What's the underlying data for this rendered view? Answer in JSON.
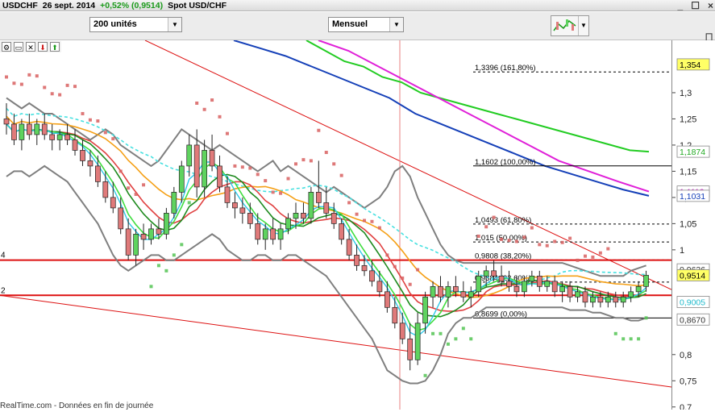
{
  "window": {
    "symbol": "USDCHF",
    "date": "26 sept. 2014",
    "change": "+0,52% (0,9514)",
    "name": "Spot USD/CHF",
    "controls": [
      "_",
      "☐",
      "×"
    ]
  },
  "toolbar": {
    "units_select": "200 unités",
    "period_select": "Mensuel"
  },
  "footer": {
    "text": "RealTime.com - Données en fin de journée"
  },
  "colors": {
    "up": "#5fd35f",
    "down": "#e07a7a",
    "bb": "#7f7f7f",
    "green200": "#22cc22",
    "magenta": "#e020d8",
    "blue": "#1540b8",
    "orange": "#f5a016",
    "cyan": "#45e0e0",
    "red_line": "#dd1111",
    "sar": "#53c453",
    "sar_down": "#d86060"
  },
  "chart_data": {
    "type": "candlestick",
    "instrument": "USDCHF",
    "period": "Mensuel",
    "y_axis": {
      "range": [
        0.7,
        1.4
      ],
      "ticks": [
        "1,3",
        "1,25",
        "1,2",
        "1,15",
        "1,1",
        "1,05",
        "1",
        "0,8",
        "0,75",
        "0,7"
      ],
      "tick_values": [
        1.3,
        1.25,
        1.2,
        1.15,
        1.1,
        1.05,
        1.0,
        0.8,
        0.75,
        0.7
      ]
    },
    "value_tags": [
      {
        "label": "1,354",
        "value": 1.354,
        "bg": "#ffff66"
      },
      {
        "label": "1,1874",
        "value": 1.1874,
        "bg": "#ffffff",
        "color": "#22aa22"
      },
      {
        "label": "1,1112",
        "value": 1.1112,
        "bg": "#ffffff",
        "color": "#d020d0"
      },
      {
        "label": "1,1031",
        "value": 1.1031,
        "bg": "#ffffff",
        "color": "#1540b8"
      },
      {
        "label": "0,9626",
        "value": 0.9626,
        "bg": "#ffffff",
        "color": "#333333"
      },
      {
        "label": "0,9514",
        "value": 0.9514,
        "bg": "#ffff66",
        "color": "#000000"
      },
      {
        "label": "0,9005",
        "value": 0.9005,
        "bg": "#ffffff",
        "color": "#22bbcc"
      },
      {
        "label": "0,8670",
        "value": 0.867,
        "bg": "#ffffff",
        "color": "#333333"
      }
    ],
    "fibonacci": [
      {
        "label": "1,3396 (161,80%)",
        "value": 1.3396
      },
      {
        "label": "1,1602 (100,00%)",
        "value": 1.1602
      },
      {
        "label": "1,0493 (61,80%)",
        "value": 1.0493
      },
      {
        "label": "1,015 (50,00%)",
        "value": 1.015
      },
      {
        "label": "0,9808 (38,20%)",
        "value": 0.9808
      },
      {
        "label": "0,9384 (23,60%)",
        "value": 0.9384
      },
      {
        "label": "0,8699 (0,00%)",
        "value": 0.8699
      }
    ],
    "horizontal_levels": [
      {
        "label": "4",
        "value": 0.9804
      },
      {
        "label": "2",
        "value": 0.9131
      }
    ],
    "candles": [
      [
        1.25,
        1.28,
        1.22,
        1.24
      ],
      [
        1.24,
        1.26,
        1.2,
        1.21
      ],
      [
        1.21,
        1.25,
        1.19,
        1.24
      ],
      [
        1.24,
        1.26,
        1.21,
        1.22
      ],
      [
        1.22,
        1.25,
        1.2,
        1.24
      ],
      [
        1.24,
        1.26,
        1.21,
        1.22
      ],
      [
        1.22,
        1.24,
        1.19,
        1.21
      ],
      [
        1.21,
        1.23,
        1.19,
        1.22
      ],
      [
        1.22,
        1.24,
        1.2,
        1.21
      ],
      [
        1.21,
        1.23,
        1.18,
        1.19
      ],
      [
        1.19,
        1.21,
        1.16,
        1.17
      ],
      [
        1.17,
        1.19,
        1.14,
        1.16
      ],
      [
        1.16,
        1.18,
        1.12,
        1.13
      ],
      [
        1.13,
        1.15,
        1.09,
        1.1
      ],
      [
        1.1,
        1.13,
        1.07,
        1.08
      ],
      [
        1.08,
        1.1,
        1.03,
        1.04
      ],
      [
        1.04,
        1.06,
        0.98,
        0.99
      ],
      [
        0.99,
        1.04,
        0.97,
        1.03
      ],
      [
        1.03,
        1.05,
        1.0,
        1.02
      ],
      [
        1.02,
        1.05,
        1.01,
        1.04
      ],
      [
        1.04,
        1.06,
        1.02,
        1.03
      ],
      [
        1.03,
        1.08,
        1.02,
        1.07
      ],
      [
        1.07,
        1.12,
        1.06,
        1.11
      ],
      [
        1.11,
        1.17,
        1.09,
        1.16
      ],
      [
        1.16,
        1.22,
        1.14,
        1.2
      ],
      [
        1.2,
        1.23,
        1.1,
        1.12
      ],
      [
        1.12,
        1.21,
        1.1,
        1.19
      ],
      [
        1.19,
        1.22,
        1.15,
        1.16
      ],
      [
        1.16,
        1.18,
        1.11,
        1.12
      ],
      [
        1.12,
        1.14,
        1.08,
        1.09
      ],
      [
        1.09,
        1.11,
        1.06,
        1.08
      ],
      [
        1.08,
        1.1,
        1.05,
        1.07
      ],
      [
        1.07,
        1.09,
        1.04,
        1.05
      ],
      [
        1.05,
        1.07,
        1.01,
        1.02
      ],
      [
        1.02,
        1.05,
        1.0,
        1.04
      ],
      [
        1.04,
        1.06,
        1.01,
        1.02
      ],
      [
        1.02,
        1.05,
        1.0,
        1.04
      ],
      [
        1.04,
        1.07,
        1.03,
        1.06
      ],
      [
        1.06,
        1.09,
        1.04,
        1.07
      ],
      [
        1.07,
        1.09,
        1.05,
        1.06
      ],
      [
        1.06,
        1.12,
        1.05,
        1.11
      ],
      [
        1.11,
        1.17,
        1.08,
        1.09
      ],
      [
        1.09,
        1.12,
        1.06,
        1.07
      ],
      [
        1.07,
        1.09,
        1.04,
        1.05
      ],
      [
        1.05,
        1.06,
        1.01,
        1.02
      ],
      [
        1.02,
        1.04,
        0.98,
        0.99
      ],
      [
        0.99,
        1.01,
        0.96,
        0.97
      ],
      [
        0.97,
        0.99,
        0.95,
        0.96
      ],
      [
        0.96,
        0.98,
        0.93,
        0.94
      ],
      [
        0.94,
        0.96,
        0.91,
        0.92
      ],
      [
        0.92,
        0.94,
        0.88,
        0.89
      ],
      [
        0.89,
        0.91,
        0.85,
        0.86
      ],
      [
        0.86,
        0.88,
        0.82,
        0.83
      ],
      [
        0.83,
        0.86,
        0.77,
        0.79
      ],
      [
        0.79,
        0.88,
        0.78,
        0.86
      ],
      [
        0.86,
        0.92,
        0.84,
        0.91
      ],
      [
        0.91,
        0.94,
        0.89,
        0.93
      ],
      [
        0.93,
        0.95,
        0.9,
        0.91
      ],
      [
        0.91,
        0.94,
        0.89,
        0.93
      ],
      [
        0.93,
        0.95,
        0.91,
        0.92
      ],
      [
        0.92,
        0.94,
        0.9,
        0.91
      ],
      [
        0.91,
        0.93,
        0.89,
        0.92
      ],
      [
        0.92,
        0.96,
        0.91,
        0.95
      ],
      [
        0.95,
        0.97,
        0.93,
        0.96
      ],
      [
        0.96,
        0.98,
        0.94,
        0.95
      ],
      [
        0.95,
        0.97,
        0.93,
        0.94
      ],
      [
        0.94,
        0.96,
        0.92,
        0.93
      ],
      [
        0.93,
        0.95,
        0.91,
        0.92
      ],
      [
        0.92,
        0.95,
        0.91,
        0.94
      ],
      [
        0.94,
        0.96,
        0.93,
        0.95
      ],
      [
        0.95,
        0.96,
        0.92,
        0.93
      ],
      [
        0.93,
        0.95,
        0.92,
        0.94
      ],
      [
        0.94,
        0.95,
        0.91,
        0.92
      ],
      [
        0.92,
        0.94,
        0.9,
        0.93
      ],
      [
        0.93,
        0.94,
        0.9,
        0.91
      ],
      [
        0.91,
        0.93,
        0.9,
        0.92
      ],
      [
        0.92,
        0.93,
        0.89,
        0.9
      ],
      [
        0.9,
        0.92,
        0.89,
        0.91
      ],
      [
        0.91,
        0.92,
        0.89,
        0.9
      ],
      [
        0.9,
        0.92,
        0.89,
        0.91
      ],
      [
        0.91,
        0.92,
        0.89,
        0.9
      ],
      [
        0.9,
        0.92,
        0.89,
        0.91
      ],
      [
        0.91,
        0.93,
        0.9,
        0.92
      ],
      [
        0.92,
        0.94,
        0.91,
        0.93
      ],
      [
        0.93,
        0.96,
        0.92,
        0.9514
      ]
    ],
    "indicators": {
      "bollinger_upper": [
        1.29,
        1.28,
        1.27,
        1.28,
        1.27,
        1.26,
        1.26,
        1.25,
        1.24,
        1.23,
        1.22,
        1.21,
        1.22,
        1.23,
        1.22,
        1.2,
        1.19,
        1.18,
        1.17,
        1.16,
        1.17,
        1.19,
        1.21,
        1.23,
        1.22,
        1.21,
        1.2,
        1.19,
        1.2,
        1.19,
        1.18,
        1.17,
        1.16,
        1.15,
        1.16,
        1.17,
        1.15,
        1.16,
        1.15,
        1.14,
        1.13,
        1.12,
        1.11,
        1.12,
        1.11,
        1.1,
        1.09,
        1.08,
        1.09,
        1.1,
        1.12,
        1.15,
        1.16,
        1.14,
        1.1,
        1.07,
        1.04,
        1.01,
        0.99,
        0.98,
        0.975,
        0.975,
        0.975,
        0.975,
        0.975,
        0.975,
        0.975,
        0.975,
        0.975,
        0.975,
        0.975,
        0.975,
        0.975,
        0.975,
        0.97,
        0.965,
        0.96,
        0.955,
        0.95,
        0.95,
        0.95,
        0.95,
        0.96,
        0.965,
        0.97
      ],
      "bollinger_lower": [
        1.14,
        1.15,
        1.15,
        1.14,
        1.15,
        1.16,
        1.15,
        1.14,
        1.13,
        1.11,
        1.09,
        1.07,
        1.05,
        1.02,
        0.99,
        0.97,
        0.96,
        0.97,
        0.98,
        0.99,
        0.99,
        0.98,
        0.98,
        0.99,
        1.0,
        1.01,
        1.02,
        1.03,
        1.02,
        1.0,
        0.99,
        0.98,
        0.98,
        0.99,
        0.99,
        0.98,
        0.98,
        0.99,
        0.99,
        0.98,
        0.97,
        0.96,
        0.95,
        0.93,
        0.91,
        0.89,
        0.87,
        0.85,
        0.83,
        0.8,
        0.77,
        0.76,
        0.75,
        0.745,
        0.745,
        0.75,
        0.77,
        0.8,
        0.84,
        0.86,
        0.87,
        0.87,
        0.88,
        0.89,
        0.89,
        0.89,
        0.89,
        0.89,
        0.89,
        0.89,
        0.89,
        0.89,
        0.89,
        0.89,
        0.885,
        0.885,
        0.885,
        0.88,
        0.88,
        0.875,
        0.87,
        0.87,
        0.865,
        0.865,
        0.87
      ]
    }
  }
}
